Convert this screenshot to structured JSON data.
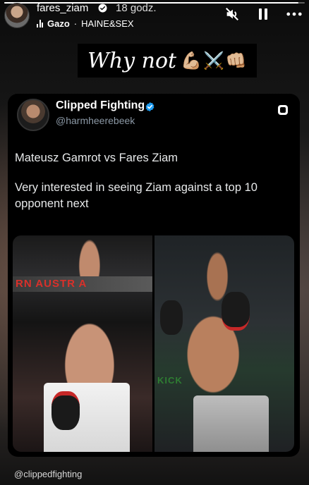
{
  "story": {
    "progress": 0.98,
    "username": "fares_ziam",
    "time": "18 godz.",
    "music": {
      "artist": "Gazo",
      "track": "HAINE&SEX"
    },
    "controls": [
      "mute-icon",
      "pause-icon",
      "more-icon"
    ]
  },
  "caption": {
    "text": "Why not",
    "emojis": [
      "💪🏼",
      "⚔️",
      "👊🏼"
    ]
  },
  "tweet": {
    "name": "Clipped Fighting",
    "handle": "@harmheerebeek",
    "text_line1": "Mateusz Gamrot vs Fares Ziam",
    "text_line2": "Very interested in seeing Ziam against a top 10 opponent next",
    "photo_left_banner": "RN AUSTR   A",
    "photo_right_fence": "KICK"
  },
  "footer": {
    "handle": "@clippedfighting"
  },
  "colors": {
    "verified_blue": "#1d9bf0",
    "handle_gray": "#8b98a5"
  }
}
